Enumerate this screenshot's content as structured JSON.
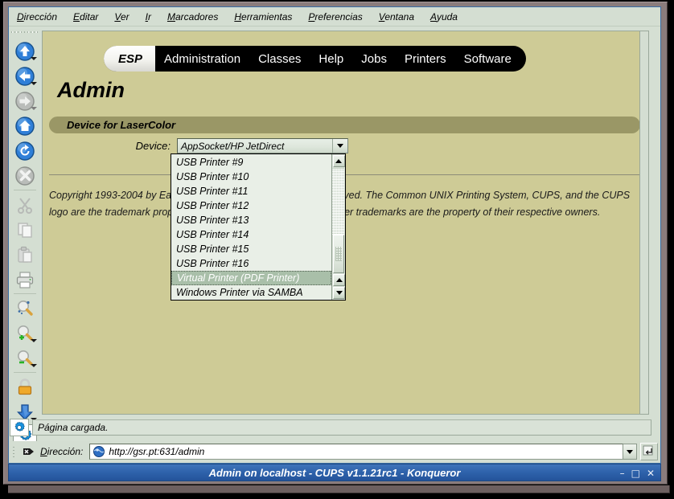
{
  "window": {
    "title": "Admin on localhost - CUPS v1.1.21rc1 - Konqueror",
    "minimize_label": "–",
    "maximize_label": "□",
    "close_label": "✕"
  },
  "menubar": {
    "items": [
      {
        "name": "direccion",
        "accel": "D",
        "rest": "irección"
      },
      {
        "name": "editar",
        "accel": "E",
        "rest": "ditar"
      },
      {
        "name": "ver",
        "accel": "V",
        "rest": "er"
      },
      {
        "name": "ir",
        "accel": "I",
        "rest": "r"
      },
      {
        "name": "marcadores",
        "accel": "M",
        "rest": "arcadores"
      },
      {
        "name": "herramientas",
        "accel": "H",
        "rest": "erramientas"
      },
      {
        "name": "preferencias",
        "accel": "P",
        "rest": "referencias"
      },
      {
        "name": "ventana",
        "accel": "V",
        "rest": "entana"
      },
      {
        "name": "ayuda",
        "accel": "A",
        "rest": "yuda"
      }
    ]
  },
  "toolbar": {
    "buttons": [
      {
        "icon": "up-arrow-icon",
        "label": "Arriba",
        "state": "enabled",
        "has_menu": true
      },
      {
        "icon": "back-arrow-icon",
        "label": "Atrás",
        "state": "enabled",
        "has_menu": true
      },
      {
        "icon": "forward-arrow-icon",
        "label": "Adelante",
        "state": "disabled",
        "has_menu": true
      },
      {
        "icon": "home-icon",
        "label": "Inicio",
        "state": "enabled",
        "has_menu": false
      },
      {
        "icon": "reload-icon",
        "label": "Recargar",
        "state": "enabled",
        "has_menu": false
      },
      {
        "icon": "stop-icon",
        "label": "Detener",
        "state": "disabled",
        "has_menu": false
      },
      {
        "icon": "cut-scissors-icon",
        "label": "Cortar",
        "state": "disabled",
        "has_menu": false
      },
      {
        "icon": "copy-icon",
        "label": "Copiar",
        "state": "disabled",
        "has_menu": false
      },
      {
        "icon": "paste-icon",
        "label": "Pegar",
        "state": "disabled",
        "has_menu": false
      },
      {
        "icon": "print-icon",
        "label": "Imprimir",
        "state": "enabled",
        "has_menu": false
      },
      {
        "icon": "find-icon",
        "label": "Buscar",
        "state": "enabled",
        "has_menu": false
      },
      {
        "icon": "zoom-in-icon",
        "label": "Aumentar tamaño de letra",
        "state": "enabled",
        "has_menu": true
      },
      {
        "icon": "zoom-out-icon",
        "label": "Disminuir tamaño de letra",
        "state": "enabled",
        "has_menu": true
      },
      {
        "icon": "padlock-icon",
        "label": "Seguridad",
        "state": "enabled",
        "has_menu": false
      },
      {
        "icon": "download-arrow-icon",
        "label": "Descargas",
        "state": "enabled",
        "has_menu": true
      },
      {
        "icon": "gear-icon",
        "label": "Configurar",
        "state": "pressed",
        "has_menu": false
      }
    ]
  },
  "page": {
    "tabs": [
      {
        "label": "ESP",
        "active": true
      },
      {
        "label": "Administration",
        "active": false
      },
      {
        "label": "Classes",
        "active": false
      },
      {
        "label": "Help",
        "active": false
      },
      {
        "label": "Jobs",
        "active": false
      },
      {
        "label": "Printers",
        "active": false
      },
      {
        "label": "Software",
        "active": false
      }
    ],
    "heading": "Admin",
    "section_title": "Device for LaserColor",
    "device_field": {
      "label": "Device:",
      "value": "AppSocket/HP JetDirect"
    },
    "dropdown": {
      "options": [
        "USB Printer #9",
        "USB Printer #10",
        "USB Printer #11",
        "USB Printer #12",
        "USB Printer #13",
        "USB Printer #14",
        "USB Printer #15",
        "USB Printer #16",
        "Virtual Printer (PDF Printer)",
        "Windows Printer via SAMBA"
      ],
      "selected": "Virtual Printer (PDF Printer)",
      "selected_index": 8
    },
    "copyright": {
      "part1": "Copyright 1993-2004 by Easy Software Products, All Rights Reserved. The Common UNIX Printing System, CUPS, and the CUPS logo are the trademark property of ",
      "link": "Easy Software Products",
      "part2": ". All other trademarks are the property of their respective owners."
    }
  },
  "status": {
    "text": "Página cargada.",
    "icon": "gear-icon"
  },
  "location": {
    "label_accel": "D",
    "label_rest": "irección:",
    "url": "http://gsr.pt:631/admin",
    "favicon": "konqueror-globe-icon",
    "clear_icon": "clear-location-icon",
    "dropdown_icon": "chevron-down-icon",
    "go_icon": "go-enter-icon"
  },
  "colors": {
    "page_background": "#cecb96",
    "section_bar": "#9a9766",
    "tab_bar": "#000000",
    "active_tab": "#f3f3ef",
    "link": "#2222cc",
    "titlebar": "#2e62ab",
    "window_frame": "#8a7c7c",
    "toolbar": "#d4ded2",
    "selection": "#a9bfa9"
  }
}
